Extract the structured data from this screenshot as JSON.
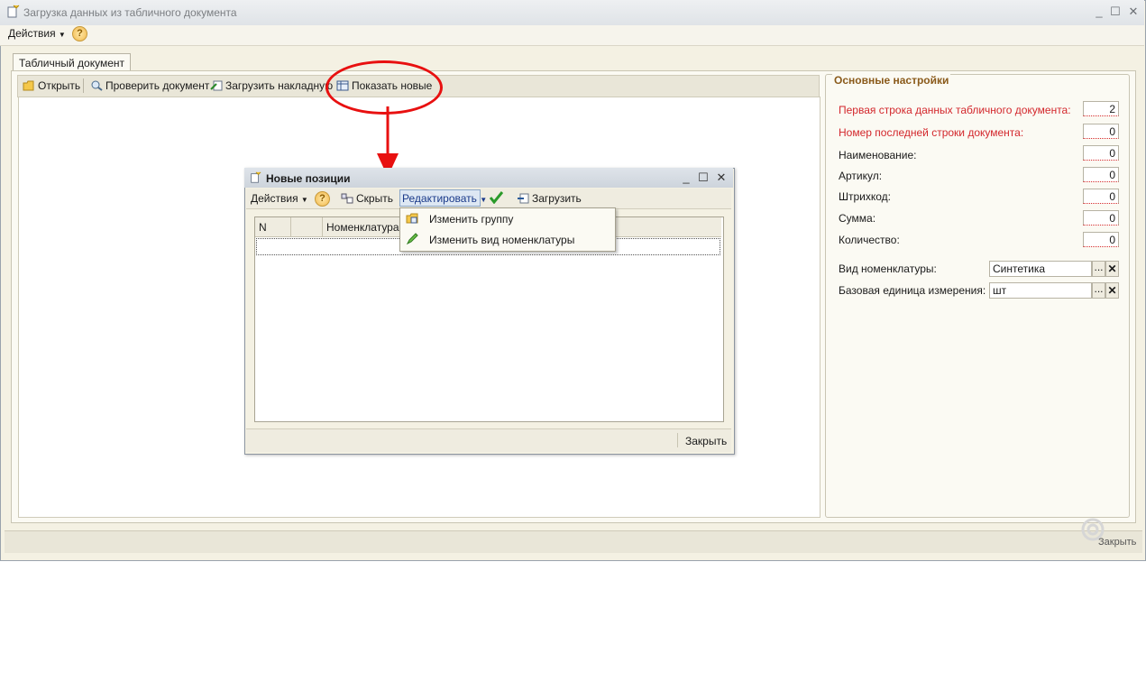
{
  "main_window": {
    "title": "Загрузка данных из табличного документа",
    "menu_actions": "Действия",
    "help": "?",
    "tab_label": "Табличный документ",
    "toolbar": {
      "open": "Открыть",
      "check": "Проверить документ",
      "load_invoice": "Загрузить накладную",
      "show_new": "Показать новые"
    },
    "close_status": "Закрыть"
  },
  "settings": {
    "title": "Основные настройки",
    "fields": [
      {
        "label": "Первая строка данных табличного документа:",
        "value": "2"
      },
      {
        "label": "Номер последней строки документа:",
        "value": "0"
      },
      {
        "label": "Наименование:",
        "value": "0"
      },
      {
        "label": "Артикул:",
        "value": "0"
      },
      {
        "label": "Штрихкод:",
        "value": "0"
      },
      {
        "label": "Сумма:",
        "value": "0"
      },
      {
        "label": "Количество:",
        "value": "0"
      }
    ],
    "nomenclature_type_label": "Вид номенклатуры:",
    "nomenclature_type_value": "Синтетика",
    "unit_label": "Базовая единица измерения:",
    "unit_value": "шт",
    "dots": "...",
    "clear": "✕"
  },
  "dialog": {
    "title": "Новые позиции",
    "actions": "Действия",
    "help": "?",
    "hide": "Скрыть",
    "edit": "Редактировать",
    "load": "Загрузить",
    "columns": [
      "N",
      "",
      "Номенклатура"
    ],
    "close": "Закрыть",
    "menu": {
      "change_group": "Изменить группу",
      "change_type": "Изменить вид номенклатуры"
    }
  },
  "window_buttons": {
    "minimize": "_",
    "maximize": "☐",
    "close": "✕"
  },
  "accent_color": "#e81010"
}
